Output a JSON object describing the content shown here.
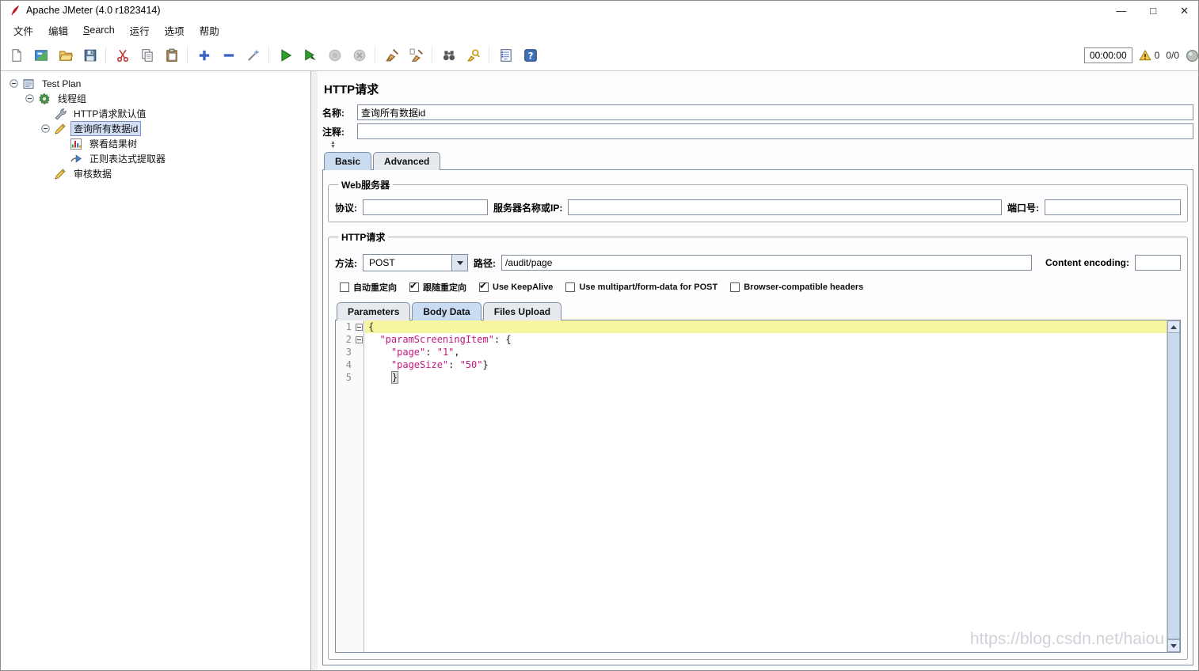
{
  "titlebar": {
    "title": "Apache JMeter (4.0 r1823414)",
    "controls": {
      "minimize": "—",
      "maximize": "□",
      "close": "✕"
    }
  },
  "menubar": {
    "items": [
      {
        "name": "file",
        "label": "文件"
      },
      {
        "name": "edit",
        "label": "编辑"
      },
      {
        "name": "search",
        "label": "Search",
        "underline_first": true
      },
      {
        "name": "run",
        "label": "运行"
      },
      {
        "name": "options",
        "label": "选项"
      },
      {
        "name": "help",
        "label": "帮助"
      }
    ]
  },
  "toolbar": {
    "buttons": [
      {
        "name": "new-file",
        "icon": "new-file-icon"
      },
      {
        "name": "templates",
        "icon": "templates-icon"
      },
      {
        "name": "open-file",
        "icon": "open-folder-icon"
      },
      {
        "name": "save",
        "icon": "save-icon"
      },
      {
        "sep": true
      },
      {
        "name": "cut",
        "icon": "cut-icon"
      },
      {
        "name": "copy",
        "icon": "copy-icon"
      },
      {
        "name": "paste",
        "icon": "paste-icon"
      },
      {
        "sep": true
      },
      {
        "name": "expand-all",
        "icon": "expand-all-icon"
      },
      {
        "name": "collapse-all",
        "icon": "collapse-all-icon"
      },
      {
        "name": "toggle",
        "icon": "toggle-icon"
      },
      {
        "sep": true
      },
      {
        "name": "start",
        "icon": "start-icon"
      },
      {
        "name": "start-no-pauses",
        "icon": "start-no-pauses-icon"
      },
      {
        "name": "stop",
        "icon": "stop-icon",
        "disabled": true
      },
      {
        "name": "shutdown",
        "icon": "shutdown-icon",
        "disabled": true
      },
      {
        "sep": true
      },
      {
        "name": "clear",
        "icon": "clear-icon"
      },
      {
        "name": "clear-all",
        "icon": "clear-all-icon"
      },
      {
        "sep": true
      },
      {
        "name": "search",
        "icon": "search-icon"
      },
      {
        "name": "search-reset",
        "icon": "search-reset-icon"
      },
      {
        "sep": true
      },
      {
        "name": "function-helper",
        "icon": "function-helper-icon"
      },
      {
        "name": "help",
        "icon": "help-icon"
      }
    ],
    "timer": "00:00:00",
    "warning_count": "0",
    "thread_status": "0/0"
  },
  "tree": {
    "nodes": [
      {
        "name": "test-plan",
        "label": "Test Plan",
        "depth": 0,
        "icon": "test-plan-icon",
        "expandable": true
      },
      {
        "name": "thread-group",
        "label": "线程组",
        "depth": 1,
        "icon": "thread-group-icon",
        "expandable": true
      },
      {
        "name": "http-request-defaults",
        "label": "HTTP请求默认值",
        "depth": 2,
        "icon": "wrench-icon"
      },
      {
        "name": "query-all-data-id",
        "label": "查询所有数据id",
        "depth": 2,
        "icon": "pencil-icon",
        "expandable": true,
        "selected": true
      },
      {
        "name": "view-results-tree",
        "label": "察看结果树",
        "depth": 3,
        "icon": "results-tree-icon"
      },
      {
        "name": "regex-extractor",
        "label": "正则表达式提取器",
        "depth": 3,
        "icon": "arrow-icon"
      },
      {
        "name": "audit-data",
        "label": "审核数据",
        "depth": 2,
        "icon": "pencil-icon"
      }
    ]
  },
  "panel": {
    "title": "HTTP请求",
    "name_label": "名称:",
    "name_value": "查询所有数据id",
    "comment_label": "注释:",
    "comment_value": ""
  },
  "outer_tabs": [
    {
      "name": "basic",
      "label": "Basic",
      "selected": true
    },
    {
      "name": "advanced",
      "label": "Advanced",
      "selected": false
    }
  ],
  "web_server": {
    "group_title": "Web服务器",
    "protocol_label": "协议:",
    "protocol_value": "",
    "server_label": "服务器名称或IP:",
    "server_value": "",
    "port_label": "端口号:",
    "port_value": ""
  },
  "http_request": {
    "group_title": "HTTP请求",
    "method_label": "方法:",
    "method_value": "POST",
    "path_label": "路径:",
    "path_value": "/audit/page",
    "content_encoding_label": "Content encoding:",
    "content_encoding_value": "",
    "checkboxes": [
      {
        "name": "auto-redirect",
        "label": "自动重定向",
        "checked": false
      },
      {
        "name": "follow-redirects",
        "label": "跟随重定向",
        "checked": true
      },
      {
        "name": "use-keepalive",
        "label": "Use KeepAlive",
        "checked": true
      },
      {
        "name": "use-multipart-form-data",
        "label": "Use multipart/form-data for POST",
        "checked": false
      },
      {
        "name": "browser-compatible-headers",
        "label": "Browser-compatible headers",
        "checked": false
      }
    ]
  },
  "body_tabs": [
    {
      "name": "parameters",
      "label": "Parameters",
      "selected": false
    },
    {
      "name": "body-data",
      "label": "Body Data",
      "selected": true
    },
    {
      "name": "files-upload",
      "label": "Files Upload",
      "selected": false
    }
  ],
  "body_editor": {
    "lines": [
      {
        "num": "1",
        "fold": true,
        "current": true,
        "segments": [
          {
            "text": "{",
            "type": "brace"
          }
        ]
      },
      {
        "num": "2",
        "fold": true,
        "segments": [
          {
            "text": "  ",
            "type": "plain"
          },
          {
            "text": "\"paramScreeningItem\"",
            "type": "key"
          },
          {
            "text": ": ",
            "type": "op"
          },
          {
            "text": "{",
            "type": "brace"
          }
        ]
      },
      {
        "num": "3",
        "segments": [
          {
            "text": "    ",
            "type": "plain"
          },
          {
            "text": "\"page\"",
            "type": "key"
          },
          {
            "text": ": ",
            "type": "op"
          },
          {
            "text": "\"1\"",
            "type": "str"
          },
          {
            "text": ",",
            "type": "op"
          }
        ]
      },
      {
        "num": "4",
        "segments": [
          {
            "text": "    ",
            "type": "plain"
          },
          {
            "text": "\"pageSize\"",
            "type": "key"
          },
          {
            "text": ": ",
            "type": "op"
          },
          {
            "text": "\"50\"",
            "type": "str"
          },
          {
            "text": "}",
            "type": "brace"
          }
        ]
      },
      {
        "num": "5",
        "segments": [
          {
            "text": "    ",
            "type": "plain"
          },
          {
            "text": "}",
            "type": "brace",
            "match": true
          }
        ]
      }
    ],
    "watermark": "https://blog.csdn.net/haiou"
  }
}
